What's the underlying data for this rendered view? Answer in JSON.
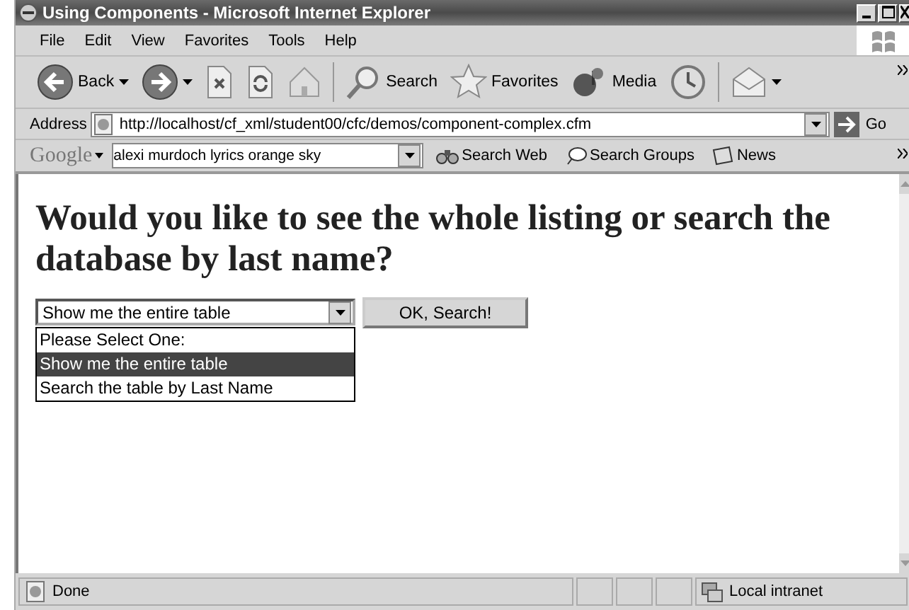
{
  "window": {
    "title": "Using Components - Microsoft Internet Explorer"
  },
  "menu": [
    "File",
    "Edit",
    "View",
    "Favorites",
    "Tools",
    "Help"
  ],
  "toolbar": [
    {
      "kind": "back",
      "label": "Back"
    },
    {
      "kind": "forward"
    },
    {
      "kind": "stop"
    },
    {
      "kind": "refresh"
    },
    {
      "kind": "home"
    },
    {
      "kind": "search",
      "label": "Search"
    },
    {
      "kind": "favorites",
      "label": "Favorites"
    },
    {
      "kind": "media",
      "label": "Media"
    },
    {
      "kind": "history"
    },
    {
      "kind": "mail"
    }
  ],
  "address": {
    "label": "Address",
    "value": "http://localhost/cf_xml/student00/cfc/demos/component-complex.cfm",
    "go": "Go"
  },
  "google": {
    "logo": "Google",
    "query": "alexi murdoch lyrics orange sky",
    "buttons": [
      {
        "kind": "web",
        "label": "Search Web"
      },
      {
        "kind": "groups",
        "label": "Search Groups"
      },
      {
        "kind": "news",
        "label": "News"
      }
    ]
  },
  "page": {
    "heading": "Would you like to see the whole listing or search the database by last name?",
    "select": {
      "value": "Show me the entire table",
      "expanded": true,
      "options": [
        {
          "label": "Please Select One:",
          "selected": false
        },
        {
          "label": "Show me the entire table",
          "selected": true
        },
        {
          "label": "Search the table by Last Name",
          "selected": false
        }
      ]
    },
    "button": "OK, Search!"
  },
  "status_bar": {
    "text": "Done",
    "zone": "Local intranet"
  }
}
